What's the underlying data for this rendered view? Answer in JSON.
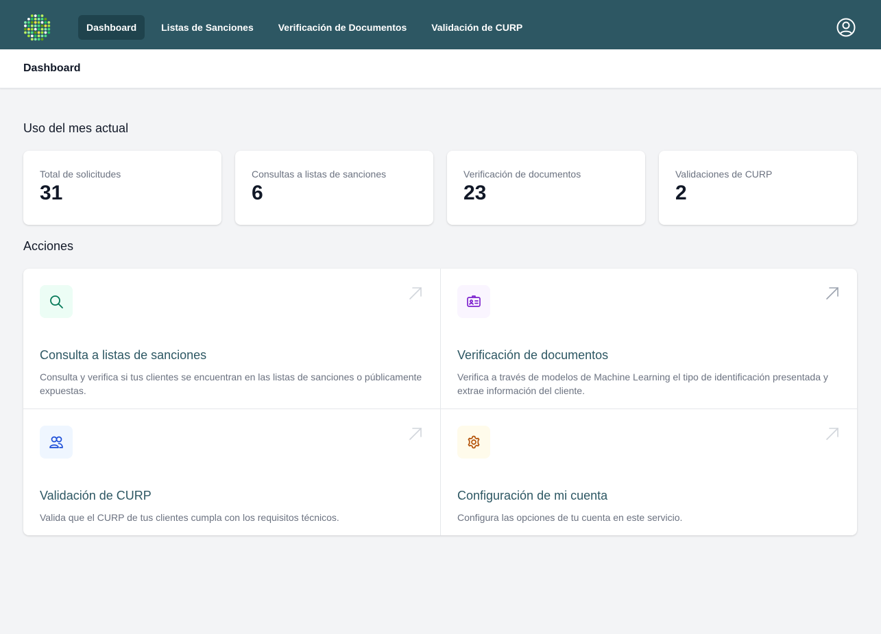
{
  "nav": {
    "items": [
      {
        "label": "Dashboard",
        "active": true
      },
      {
        "label": "Listas de Sanciones",
        "active": false
      },
      {
        "label": "Verificación de Documentos",
        "active": false
      },
      {
        "label": "Validación de CURP",
        "active": false
      }
    ],
    "user_icon": "user-circle-icon",
    "logo_icon": "dotted-logo-icon",
    "background_color": "#2d5763"
  },
  "header": {
    "title": "Dashboard"
  },
  "usage": {
    "title": "Uso del mes actual",
    "stats": [
      {
        "label": "Total de solicitudes",
        "value": "31"
      },
      {
        "label": "Consultas a listas de sanciones",
        "value": "6"
      },
      {
        "label": "Verificación de documentos",
        "value": "23"
      },
      {
        "label": "Validaciones de CURP",
        "value": "2"
      }
    ]
  },
  "actions": {
    "title": "Acciones",
    "items": [
      {
        "icon": "search-icon",
        "icon_color": "#047857",
        "icon_bg": "#ecfdf5",
        "title": "Consulta a listas de sanciones",
        "description": "Consulta y verifica si tus clientes se encuentran en las listas de sanciones o públicamente expuestas."
      },
      {
        "icon": "id-card-icon",
        "icon_color": "#7e22ce",
        "icon_bg": "#faf5ff",
        "title": "Verificación de documentos",
        "description": "Verifica a través de modelos de Machine Learning el tipo de identificación presentada y extrae información del cliente."
      },
      {
        "icon": "users-icon",
        "icon_color": "#1d4ed8",
        "icon_bg": "#eff6ff",
        "title": "Validación de CURP",
        "description": "Valida que el CURP de tus clientes cumpla con los requisitos técnicos."
      },
      {
        "icon": "gear-icon",
        "icon_color": "#b45309",
        "icon_bg": "#fffbeb",
        "title": "Configuración de mi cuenta",
        "description": "Configura las opciones de tu cuenta en este servicio."
      }
    ]
  }
}
